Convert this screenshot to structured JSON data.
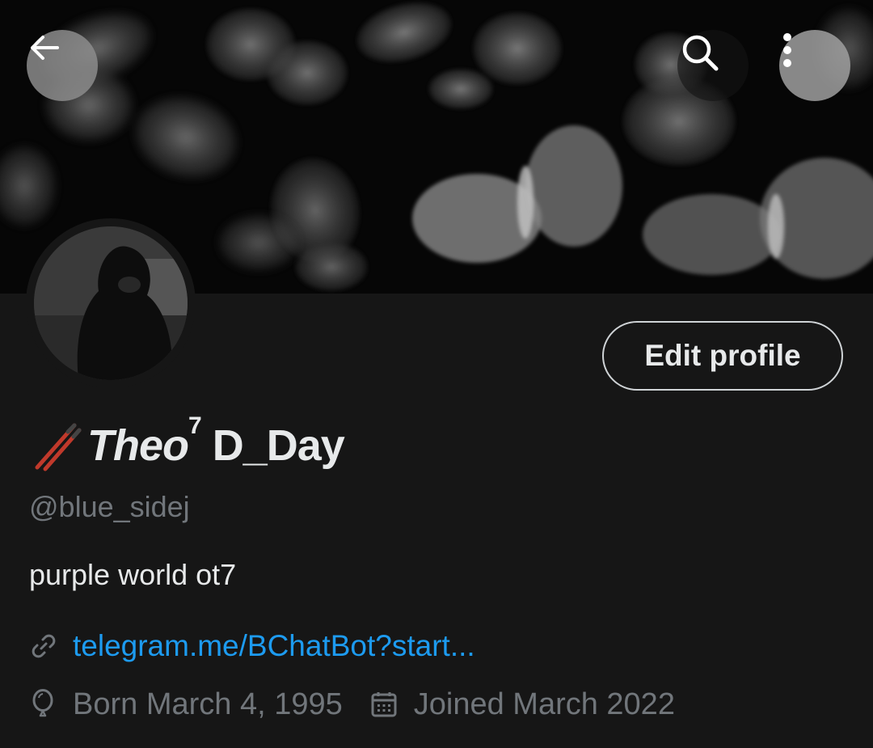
{
  "header": {
    "back_icon": "arrow-left-icon",
    "search_icon": "search-icon",
    "more_icon": "more-vertical-icon"
  },
  "profile": {
    "name_emoji": "chopsticks",
    "name_italic": "Theo",
    "name_sup": "7",
    "name_rest": "D_Day",
    "handle": "@blue_sidej",
    "bio": "purple world ot7",
    "website": "telegram.me/BChatBot?start...",
    "born": "Born March 4, 1995",
    "joined": "Joined March 2022"
  },
  "actions": {
    "edit_profile_label": "Edit profile"
  },
  "colors": {
    "background": "#161616",
    "link": "#1d9bf0",
    "secondary_text": "#71767b"
  }
}
